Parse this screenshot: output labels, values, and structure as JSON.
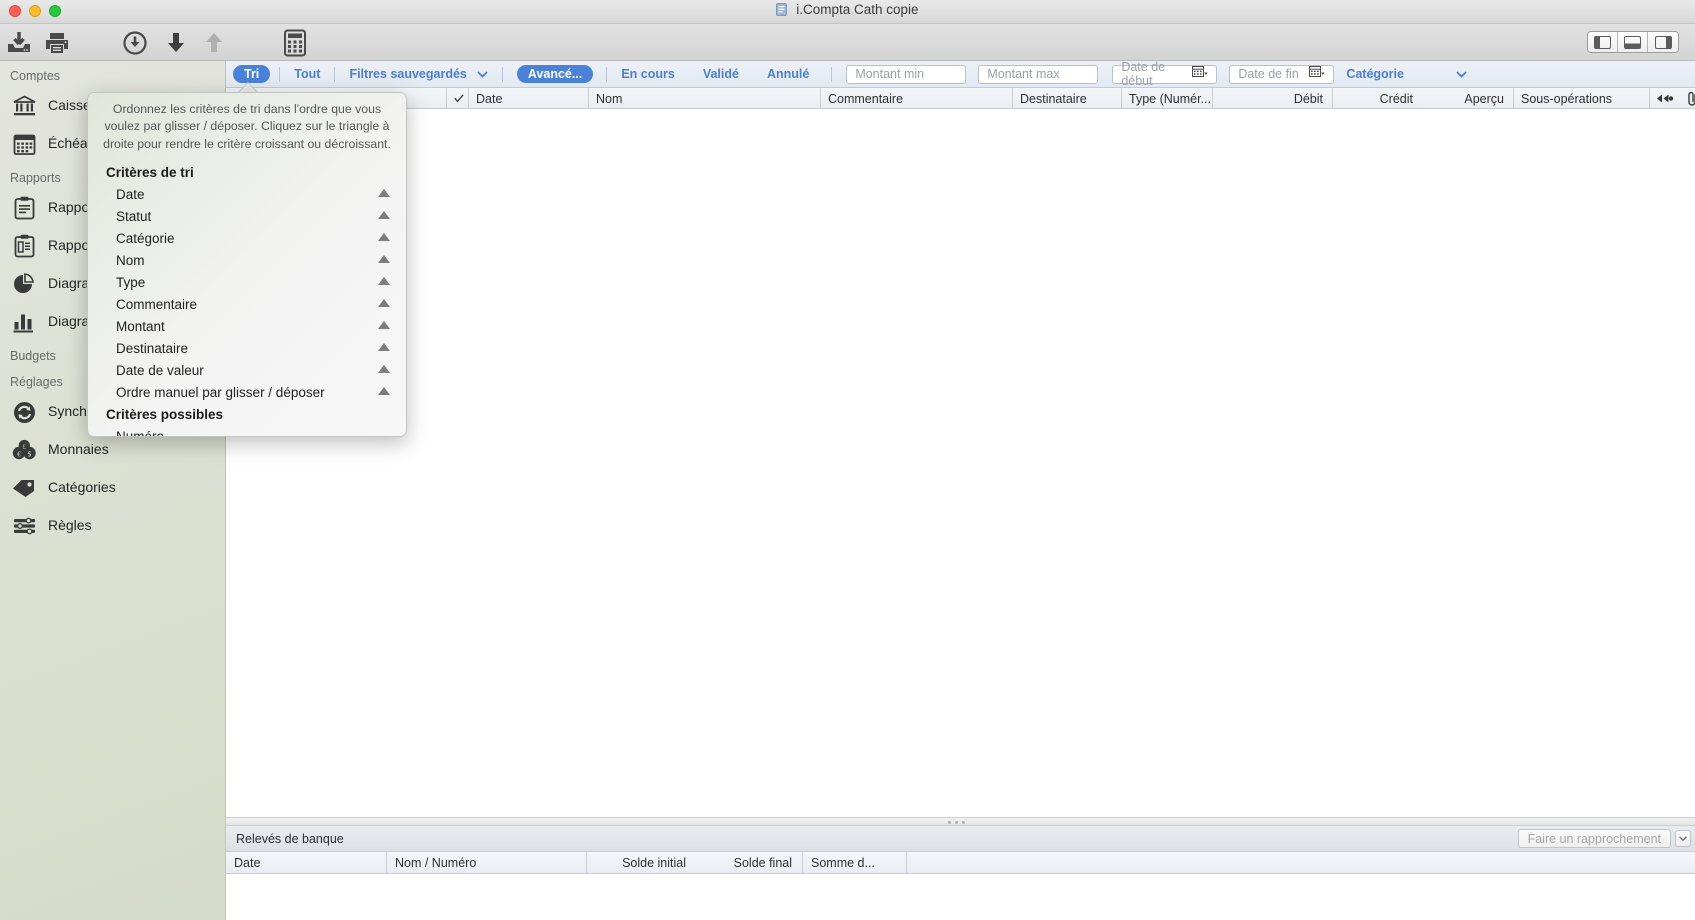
{
  "window": {
    "title": "i.Compta Cath copie"
  },
  "toolbar": {
    "buttons": [
      {
        "name": "import-icon",
        "label": "Importer"
      },
      {
        "name": "print-icon",
        "label": "Imprimer"
      },
      {
        "name": "download-circle-icon",
        "label": "Télécharger"
      },
      {
        "name": "arrow-down-icon",
        "label": "Débit"
      },
      {
        "name": "arrow-up-icon",
        "label": "Crédit"
      },
      {
        "name": "calculator-icon",
        "label": "Calculatrice"
      }
    ],
    "view_switch": [
      {
        "name": "view-sidebar-left-icon",
        "label": "Vue barre latérale"
      },
      {
        "name": "view-split-icon",
        "label": "Vue divisée"
      },
      {
        "name": "view-sidebar-right-icon",
        "label": "Vue inspecteur"
      }
    ]
  },
  "sidebar": {
    "groups": [
      {
        "title": "Comptes",
        "items": [
          {
            "icon": "bank-icon",
            "label": "Caisse d'Eparg"
          },
          {
            "icon": "calendar-icon",
            "label": "Échéan"
          }
        ]
      },
      {
        "title": "Rapports",
        "items": [
          {
            "icon": "clipboard-icon",
            "label": "Rappor"
          },
          {
            "icon": "clipboard-lines-icon",
            "label": "Rappor"
          },
          {
            "icon": "pie-chart-icon",
            "label": "Diagram"
          },
          {
            "icon": "bar-chart-icon",
            "label": "Diagram"
          }
        ]
      },
      {
        "title": "Budgets",
        "items": []
      },
      {
        "title": "Réglages",
        "items": [
          {
            "icon": "sync-icon",
            "label": "Synchronisation"
          },
          {
            "icon": "coins-icon",
            "label": "Monnaies"
          },
          {
            "icon": "tag-icon",
            "label": "Catégories"
          },
          {
            "icon": "rules-icon",
            "label": "Règles"
          }
        ]
      }
    ]
  },
  "filterbar": {
    "sort_button": "Tri",
    "all_button": "Tout",
    "saved_filters": "Filtres sauvegardés",
    "advanced_button": "Avancé...",
    "status_filters": [
      "En cours",
      "Validé",
      "Annulé"
    ],
    "amount_min_placeholder": "Montant min",
    "amount_max_placeholder": "Montant max",
    "date_start_placeholder": "Date de début",
    "date_end_placeholder": "Date de fin",
    "category_label": "Catégorie"
  },
  "table": {
    "columns": [
      {
        "label": "",
        "name": "checkmark-column"
      },
      {
        "label": "Date",
        "name": "date-column"
      },
      {
        "label": "Nom",
        "name": "name-column"
      },
      {
        "label": "Commentaire",
        "name": "comment-column"
      },
      {
        "label": "Destinataire",
        "name": "recipient-column"
      },
      {
        "label": "Type (Numér...",
        "name": "type-column"
      },
      {
        "label": "Débit",
        "name": "debit-column"
      },
      {
        "label": "Crédit",
        "name": "credit-column"
      },
      {
        "label": "Aperçu",
        "name": "preview-column"
      },
      {
        "label": "Sous-opérations",
        "name": "suboperations-column"
      }
    ],
    "rows": []
  },
  "bottom_panel": {
    "title": "Relevés de banque",
    "reconcile_button": "Faire un rapprochement",
    "columns": [
      "Date",
      "Nom / Numéro",
      "Solde initial",
      "Solde final",
      "Somme d..."
    ],
    "rows": []
  },
  "popover": {
    "description": "Ordonnez les critères de tri dans l'ordre que vous voulez par glisser / déposer. Cliquez sur le triangle à droite pour rendre le critère croissant ou décroissant.",
    "sort_section_title": "Critères de tri",
    "sort_criteria": [
      {
        "label": "Date",
        "direction": "ascending"
      },
      {
        "label": "Statut",
        "direction": "ascending"
      },
      {
        "label": "Catégorie",
        "direction": "ascending"
      },
      {
        "label": "Nom",
        "direction": "ascending"
      },
      {
        "label": "Type",
        "direction": "ascending"
      },
      {
        "label": "Commentaire",
        "direction": "ascending"
      },
      {
        "label": "Montant",
        "direction": "ascending"
      },
      {
        "label": "Destinataire",
        "direction": "ascending"
      },
      {
        "label": "Date de valeur",
        "direction": "ascending"
      },
      {
        "label": "Ordre manuel par glisser / déposer",
        "direction": "ascending"
      }
    ],
    "possible_section_title": "Critères possibles",
    "possible_criteria": [
      {
        "label": "Numéro"
      }
    ]
  },
  "colors": {
    "accent_blue": "#4a82d8",
    "link_blue": "#4a7fd0",
    "sidebar_green": "#dde1d3"
  }
}
